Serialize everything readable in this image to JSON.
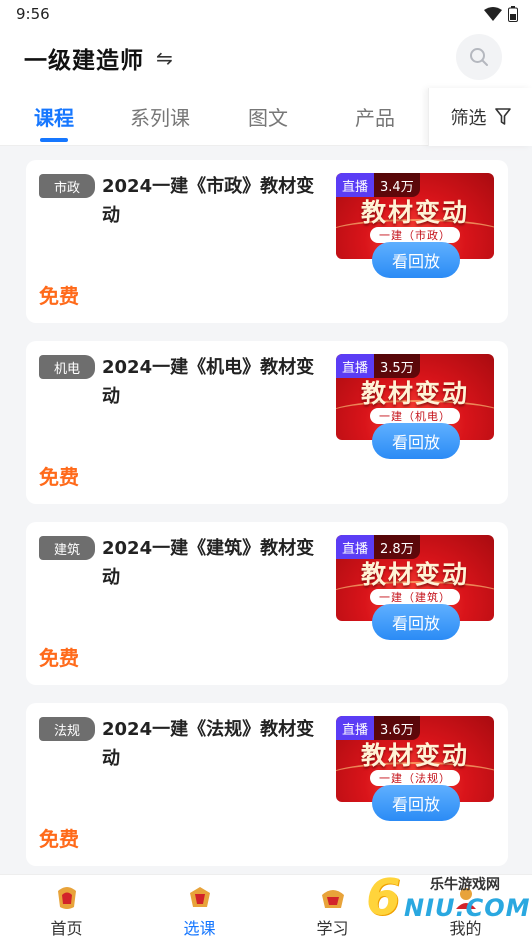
{
  "status": {
    "time": "9:56"
  },
  "header": {
    "title": "一级建造师",
    "switch_icon": "⇋"
  },
  "tabs": [
    {
      "label": "课程",
      "active": true
    },
    {
      "label": "系列课",
      "active": false
    },
    {
      "label": "图文",
      "active": false
    },
    {
      "label": "产品",
      "active": false
    }
  ],
  "filter": {
    "label": "筛选"
  },
  "courses": [
    {
      "tag": "市政",
      "title": "2024一建《市政》教材变动",
      "price": "免费",
      "thumb_title": "教材变动",
      "thumb_sub": "一建（市政）",
      "live_label": "直播",
      "live_count": "3.4万",
      "replay_label": "看回放"
    },
    {
      "tag": "机电",
      "title": "2024一建《机电》教材变动",
      "price": "免费",
      "thumb_title": "教材变动",
      "thumb_sub": "一建（机电）",
      "live_label": "直播",
      "live_count": "3.5万",
      "replay_label": "看回放"
    },
    {
      "tag": "建筑",
      "title": "2024一建《建筑》教材变动",
      "price": "免费",
      "thumb_title": "教材变动",
      "thumb_sub": "一建（建筑）",
      "live_label": "直播",
      "live_count": "2.8万",
      "replay_label": "看回放"
    },
    {
      "tag": "法规",
      "title": "2024一建《法规》教材变动",
      "price": "免费",
      "thumb_title": "教材变动",
      "thumb_sub": "一建（法规）",
      "live_label": "直播",
      "live_count": "3.6万",
      "replay_label": "看回放"
    }
  ],
  "bottom_nav": [
    {
      "label": "首页",
      "icon": "home-icon",
      "active": false
    },
    {
      "label": "选课",
      "icon": "course-select-icon",
      "active": true
    },
    {
      "label": "学习",
      "icon": "study-icon",
      "active": false
    },
    {
      "label": "我的",
      "icon": "profile-icon",
      "active": false
    }
  ],
  "watermark": {
    "brand_cn": "乐牛游戏网",
    "brand_en": "NIU.COM",
    "brand_digit": "6"
  },
  "colors": {
    "accent": "#1677ff",
    "price": "#ff6a1a",
    "live": "#5b3df5",
    "thumb_red": "#d9141a"
  }
}
